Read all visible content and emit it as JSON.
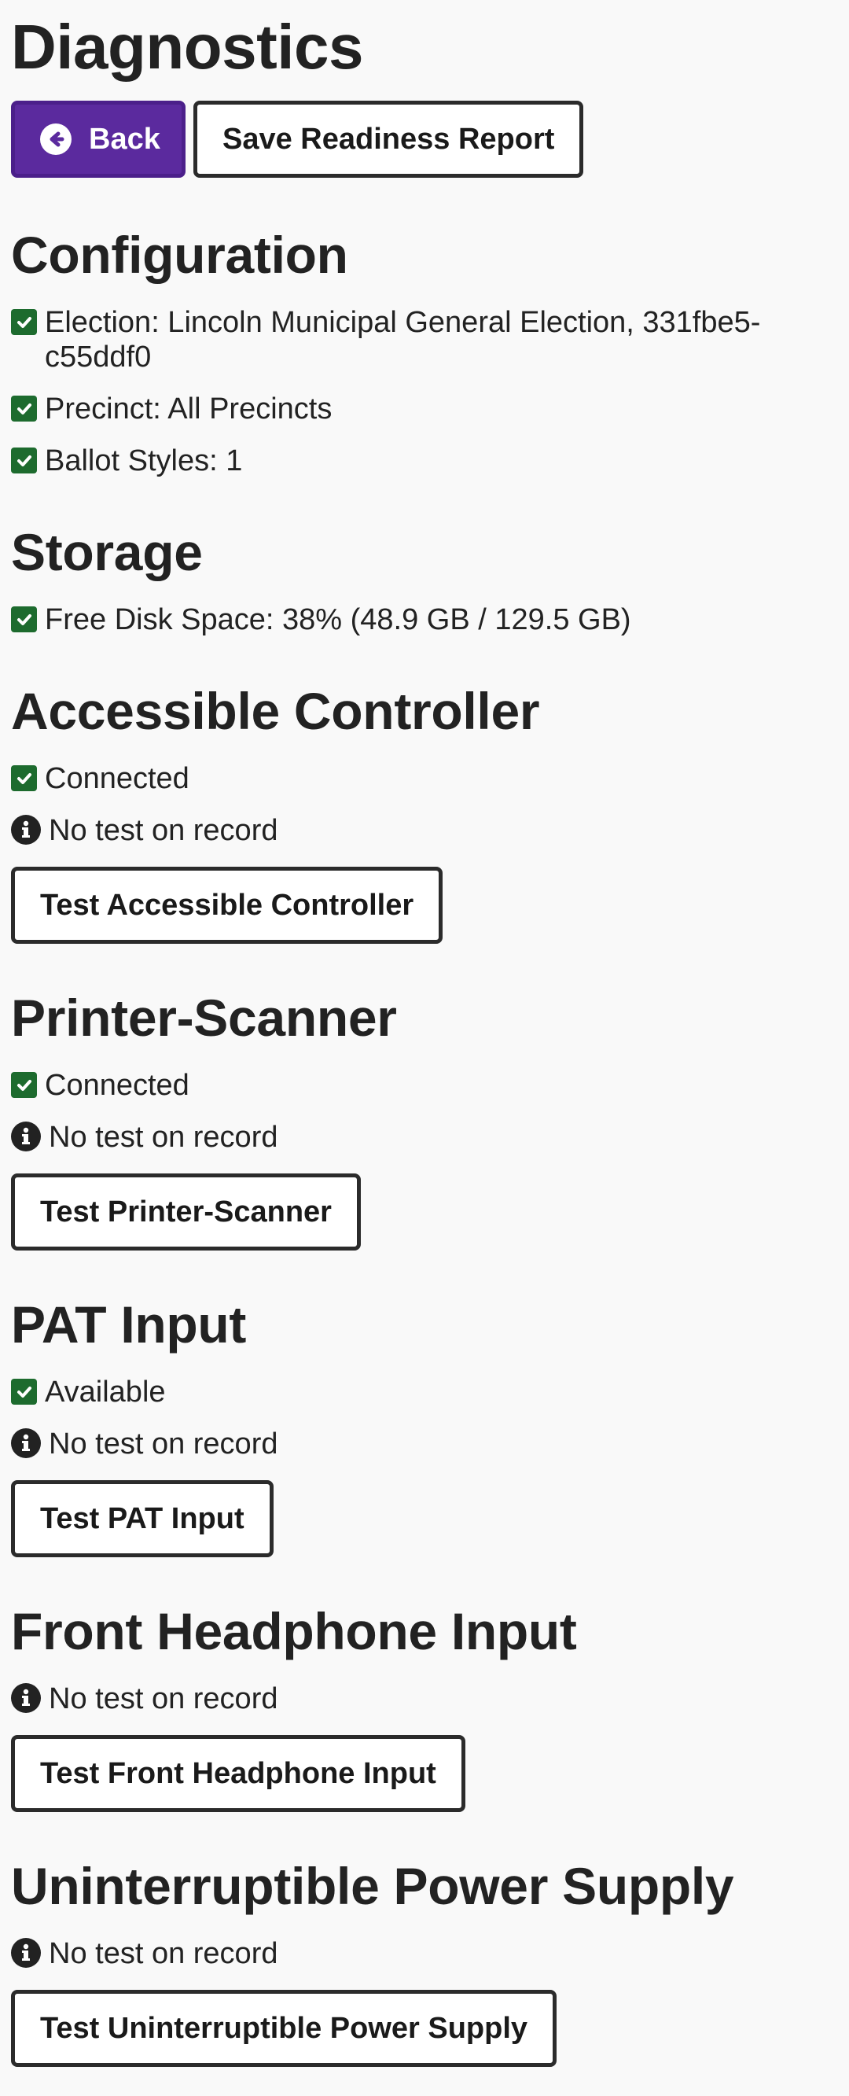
{
  "page": {
    "title": "Diagnostics",
    "back_label": "Back",
    "save_label": "Save Readiness Report"
  },
  "sections": {
    "configuration": {
      "heading": "Configuration",
      "election": "Election: Lincoln Municipal General Election, 331fbe5-c55ddf0",
      "precinct": "Precinct: All Precincts",
      "ballot_styles": "Ballot Styles: 1"
    },
    "storage": {
      "heading": "Storage",
      "free_disk": "Free Disk Space: 38% (48.9 GB / 129.5 GB)"
    },
    "controller": {
      "heading": "Accessible Controller",
      "status": "Connected",
      "test_status": "No test on record",
      "button": "Test Accessible Controller"
    },
    "printer": {
      "heading": "Printer-Scanner",
      "status": "Connected",
      "test_status": "No test on record",
      "button": "Test Printer-Scanner"
    },
    "pat": {
      "heading": "PAT Input",
      "status": "Available",
      "test_status": "No test on record",
      "button": "Test PAT Input"
    },
    "headphone": {
      "heading": "Front Headphone Input",
      "test_status": "No test on record",
      "button": "Test Front Headphone Input"
    },
    "ups": {
      "heading": "Uninterruptible Power Supply",
      "test_status": "No test on record",
      "button": "Test Uninterruptible Power Supply"
    }
  },
  "icons": {
    "ok": "check-square-icon",
    "info": "info-circle-icon",
    "back": "arrow-left-circle-icon"
  },
  "colors": {
    "primary": "#5b2a9e",
    "success": "#1d6b2e",
    "background": "#f9f9f9"
  }
}
